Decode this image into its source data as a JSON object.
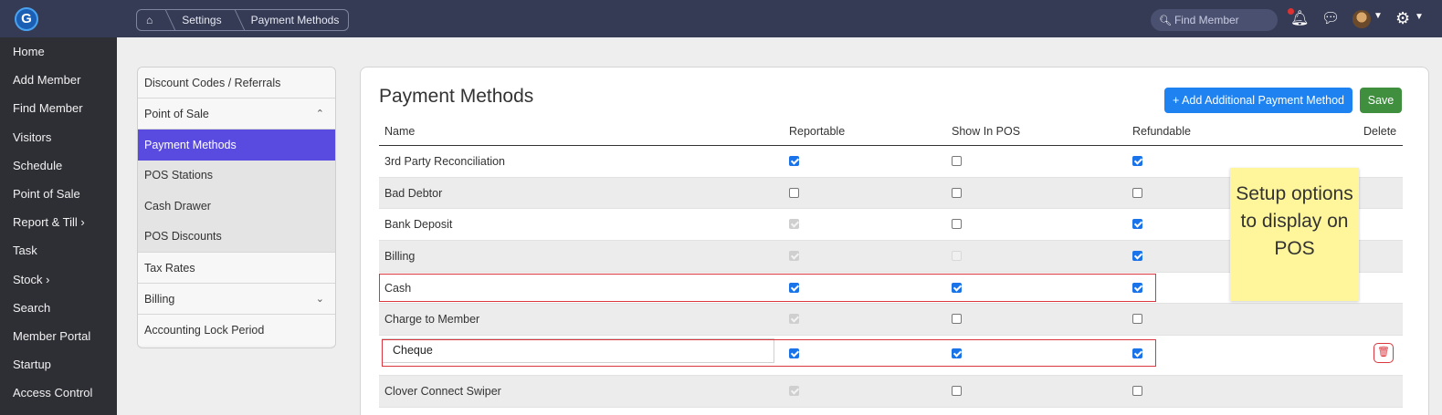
{
  "topbar": {
    "logo": "G",
    "breadcrumb": [
      "⌂",
      "Settings",
      "Payment Methods"
    ],
    "search_placeholder": "Find Member"
  },
  "sidenav": [
    "Home",
    "Add Member",
    "Find Member",
    "Visitors",
    "Schedule",
    "Point of Sale",
    "Report & Till ›",
    "Task",
    "Stock ›",
    "Search",
    "Member Portal",
    "Startup",
    "Access Control"
  ],
  "submenu": [
    "Discount Codes / Referrals",
    "Point of Sale",
    "Payment Methods",
    "POS Stations",
    "Cash Drawer",
    "POS Discounts",
    "Tax Rates",
    "Billing",
    "Accounting Lock Period"
  ],
  "panel": {
    "title": "Payment Methods",
    "add_button": "+ Add Additional Payment Method",
    "save_button": "Save"
  },
  "table": {
    "headers": [
      "Name",
      "Reportable",
      "Show In POS",
      "Refundable",
      "Delete"
    ],
    "rows": [
      {
        "name": "3rd Party Reconciliation",
        "reportable": true,
        "show_in_pos": false,
        "refundable": true
      },
      {
        "name": "Bad Debtor",
        "reportable": false,
        "show_in_pos": false,
        "refundable": false
      },
      {
        "name": "Bank Deposit",
        "reportable": true,
        "show_in_pos": false,
        "refundable": true
      },
      {
        "name": "Billing",
        "reportable": true,
        "show_in_pos": false,
        "refundable": true
      },
      {
        "name": "Cash",
        "reportable": true,
        "show_in_pos": true,
        "refundable": true
      },
      {
        "name": "Charge to Member",
        "reportable": true,
        "show_in_pos": false,
        "refundable": false
      },
      {
        "name": "Cheque",
        "reportable": true,
        "show_in_pos": true,
        "refundable": true
      },
      {
        "name": "Clover Connect Swiper",
        "reportable": true,
        "show_in_pos": false,
        "refundable": false
      }
    ]
  },
  "sticky_note": "Setup options to display on POS"
}
